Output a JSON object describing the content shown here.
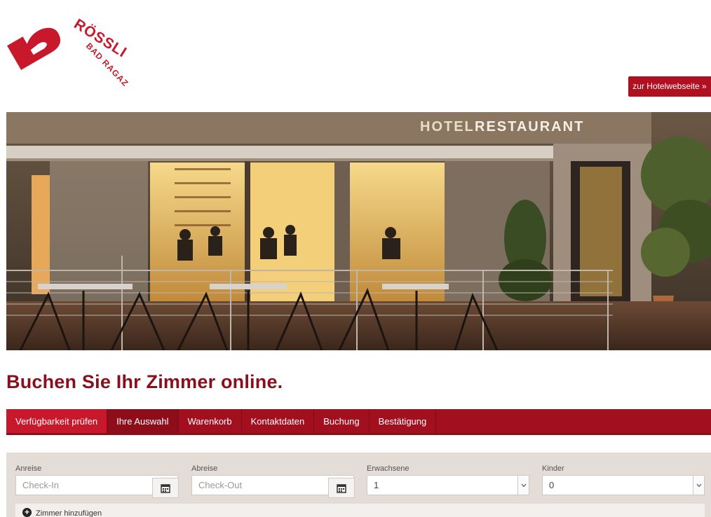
{
  "logo": {
    "name": "RÖSSLI",
    "subtitle": "BAD RAGAZ",
    "color": "#c8192c"
  },
  "header": {
    "hotel_link": "zur Hotelwebseite »"
  },
  "hero": {
    "sign_hotel": "HOTEL",
    "sign_restaurant": "RESTAURANT"
  },
  "page": {
    "title": "Buchen Sie Ihr Zimmer online."
  },
  "steps": [
    {
      "label": "Verfügbarkeit prüfen",
      "active": true
    },
    {
      "label": "Ihre Auswahl"
    },
    {
      "label": "Warenkorb"
    },
    {
      "label": "Kontaktdaten"
    },
    {
      "label": "Buchung"
    },
    {
      "label": "Bestätigung"
    }
  ],
  "form": {
    "checkin": {
      "label": "Anreise",
      "placeholder": "Check-In",
      "icon": "calendar-icon"
    },
    "checkout": {
      "label": "Abreise",
      "placeholder": "Check-Out",
      "icon": "calendar-icon"
    },
    "adults": {
      "label": "Erwachsene",
      "value": "1"
    },
    "children": {
      "label": "Kinder",
      "value": "0"
    },
    "add_room": "Zimmer hinzufügen"
  },
  "colors": {
    "brand": "#c8192c",
    "brand_dark": "#8a0f1d",
    "panel": "#e4dcd6"
  }
}
